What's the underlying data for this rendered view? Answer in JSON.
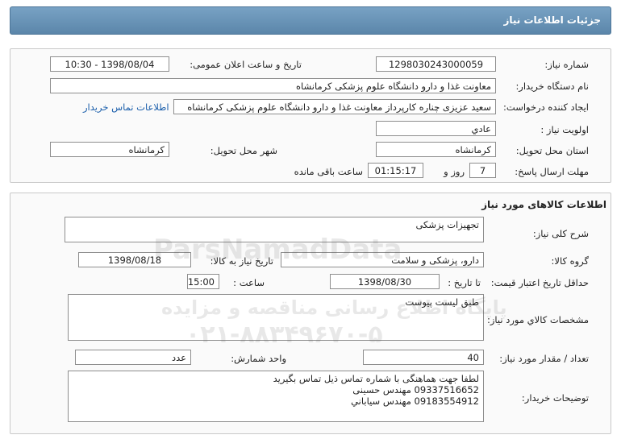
{
  "header": {
    "title": "جزئیات اطلاعات نیاز"
  },
  "info": {
    "need_number_label": "شماره نیاز:",
    "need_number": "1298030243000059",
    "announce_label": "تاریخ و ساعت اعلان عمومی:",
    "announce_value": "1398/08/04 - 10:30",
    "buyer_org_label": "نام دستگاه خریدار:",
    "buyer_org": "معاونت غذا و دارو دانشگاه علوم پزشکی کرمانشاه",
    "requester_label": "ایجاد کننده درخواست:",
    "requester": "سعید عزیزی چناره کارپرداز معاونت غذا و دارو دانشگاه علوم پزشکی کرمانشاه",
    "contact_link": "اطلاعات تماس خریدار",
    "priority_label": "اولویت نیاز :",
    "priority": "عادي",
    "province_label": "استان محل تحویل:",
    "province": "کرمانشاه",
    "city_label": "شهر محل تحویل:",
    "city": "کرمانشاه",
    "deadline_label": "مهلت ارسال پاسخ:",
    "deadline_days": "7",
    "days_and": "روز و",
    "deadline_time": "01:15:17",
    "remaining": "ساعت باقی مانده"
  },
  "goods": {
    "section_title": "اطلاعات کالاهای مورد نیاز",
    "summary_label": "شرح کلی نیاز:",
    "summary": "تجهیزات پزشکی",
    "group_label": "گروه کالا:",
    "group": "دارو، پزشکی و سلامت",
    "need_date_label": "تاریخ نیاز به کالا:",
    "need_date": "1398/08/18",
    "validity_label": "حداقل تاریخ اعتبار قیمت:",
    "until_date_label": "تا تاریخ :",
    "validity_date": "1398/08/30",
    "time_label": "ساعت :",
    "validity_time": "15:00",
    "specs_label": "مشخصات کالاي مورد نیاز:",
    "specs": "طبق لیست پیوست",
    "qty_label": "تعداد / مقدار مورد نیاز:",
    "qty": "40",
    "unit_label": "واحد شمارش:",
    "unit": "عدد",
    "buyer_notes_label": "توضیحات خریدار:",
    "buyer_notes": [
      "لطفا جهت هماهنگی با شماره تماس ذیل تماس بگیرید",
      "09337516652 مهندس حسینی",
      "09183554912 مهندس سیاباني"
    ]
  },
  "watermark": {
    "brand": "ParsNamadData",
    "line1": "پایگاه اطلاع رسانی مناقصه و مزایده",
    "phone": "۰۲۱-۸۸۳۴۹۶۷۰-۵"
  }
}
